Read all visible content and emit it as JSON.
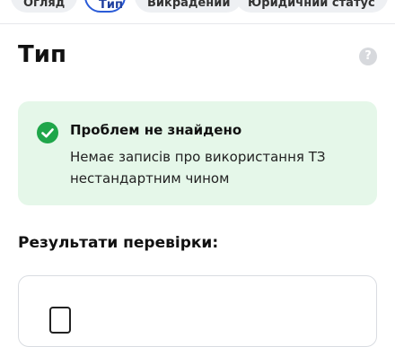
{
  "tabs": [
    {
      "label": "Огляд"
    },
    {
      "label": "Тип"
    },
    {
      "label": "Викрадений"
    },
    {
      "label": "Юридичний статус"
    }
  ],
  "active_tab": 1,
  "page": {
    "title": "Тип",
    "help_icon": "question-icon",
    "help_glyph": "?"
  },
  "status": {
    "icon": "check-circle-icon",
    "title": "Проблем не знайдено",
    "description": "Немає записів про використання ТЗ нестандартним чином",
    "color": "#1fa64a",
    "background": "#e5f7e9"
  },
  "results": {
    "title": "Результати перевірки:",
    "icon": "document-icon"
  }
}
